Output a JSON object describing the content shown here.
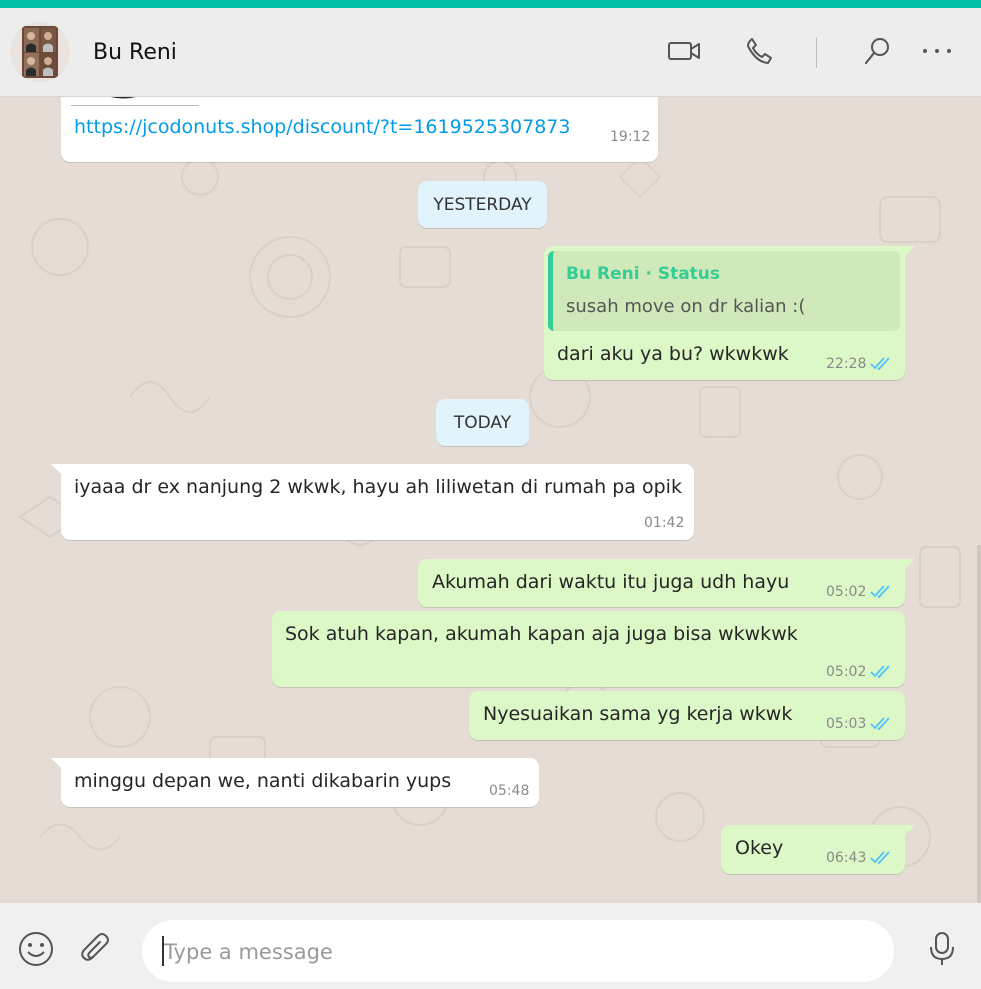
{
  "header": {
    "contact_name": "Bu Reni",
    "icons": [
      "video-call-icon",
      "voice-call-icon",
      "search-icon",
      "menu-icon"
    ]
  },
  "colors": {
    "accent": "#00bfa5",
    "incoming": "#ffffff",
    "outgoing": "#dcf8c6",
    "link": "#039be5",
    "read_ticks": "#4fc3f7",
    "quote_name": "#35cd96",
    "day_chip": "#e1f3fb"
  },
  "messages": {
    "link_msg": {
      "text": "https://jcodonuts.shop/discount/?t=1619525307873",
      "time": "19:12",
      "logo_mark": "®"
    },
    "day_yesterday": "YESTERDAY",
    "reply_msg": {
      "quote_author": "Bu Reni · Status",
      "quote_text": "susah move on dr kalian :(",
      "text": "dari aku ya bu? wkwkwk",
      "time": "22:28"
    },
    "day_today": "TODAY",
    "m1": {
      "text": "iyaaa dr ex nanjung 2 wkwk, hayu ah liliwetan di rumah pa opik",
      "time": "01:42"
    },
    "m2": {
      "text": "Akumah dari waktu itu juga udh hayu",
      "time": "05:02"
    },
    "m3": {
      "text": "Sok atuh kapan, akumah kapan aja juga bisa wkwkwk",
      "time": "05:02"
    },
    "m4": {
      "text": "Nyesuaikan sama yg kerja wkwk",
      "time": "05:03"
    },
    "m5": {
      "text": "minggu depan we, nanti dikabarin yups",
      "time": "05:48"
    },
    "m6": {
      "text": "Okey",
      "time": "06:43"
    }
  },
  "composer": {
    "placeholder": "Type a message",
    "icons": [
      "emoji-icon",
      "attach-icon",
      "microphone-icon"
    ]
  }
}
